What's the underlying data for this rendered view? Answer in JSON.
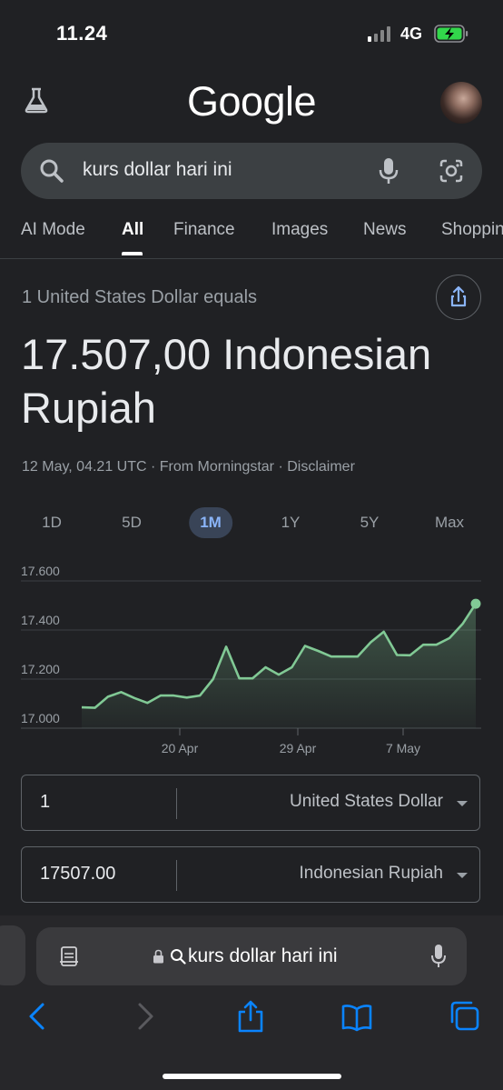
{
  "status_bar": {
    "time": "11.24",
    "network": "4G"
  },
  "header": {
    "logo": "Google",
    "labs_icon": "flask-icon",
    "avatar_icon": "profile-avatar"
  },
  "search": {
    "query": "kurs dollar hari ini"
  },
  "tabs": [
    "AI Mode",
    "All",
    "Finance",
    "Images",
    "News",
    "Shoppin"
  ],
  "active_tab": "All",
  "currency": {
    "equals_text": "1 United States Dollar equals",
    "result_line1": "17.507,00 Indonesian",
    "result_line2": "Rupiah",
    "meta": "12 May, 04.21 UTC · From Morningstar · Disclaimer"
  },
  "ranges": [
    "1D",
    "5D",
    "1M",
    "1Y",
    "5Y",
    "Max"
  ],
  "active_range": "1M",
  "chart_data": {
    "type": "area",
    "y_ticks": [
      "17.600",
      "17.400",
      "17.200",
      "17.000"
    ],
    "x_ticks": [
      "20 Apr",
      "29 Apr",
      "7 May"
    ],
    "ylim": [
      17000,
      17600
    ],
    "values": [
      17085,
      17083,
      17128,
      17147,
      17123,
      17103,
      17133,
      17133,
      17125,
      17133,
      17200,
      17332,
      17203,
      17203,
      17248,
      17218,
      17248,
      17335,
      17315,
      17292,
      17292,
      17292,
      17350,
      17393,
      17298,
      17297,
      17340,
      17340,
      17367,
      17425,
      17507
    ],
    "colors": {
      "line": "#81c995",
      "grid": "#3c4043"
    }
  },
  "converter": {
    "from_value": "1",
    "from_currency": "United States Dollar",
    "to_value": "17507.00",
    "to_currency": "Indonesian Rupiah"
  },
  "browser": {
    "url_text": "kurs dollar hari ini"
  }
}
